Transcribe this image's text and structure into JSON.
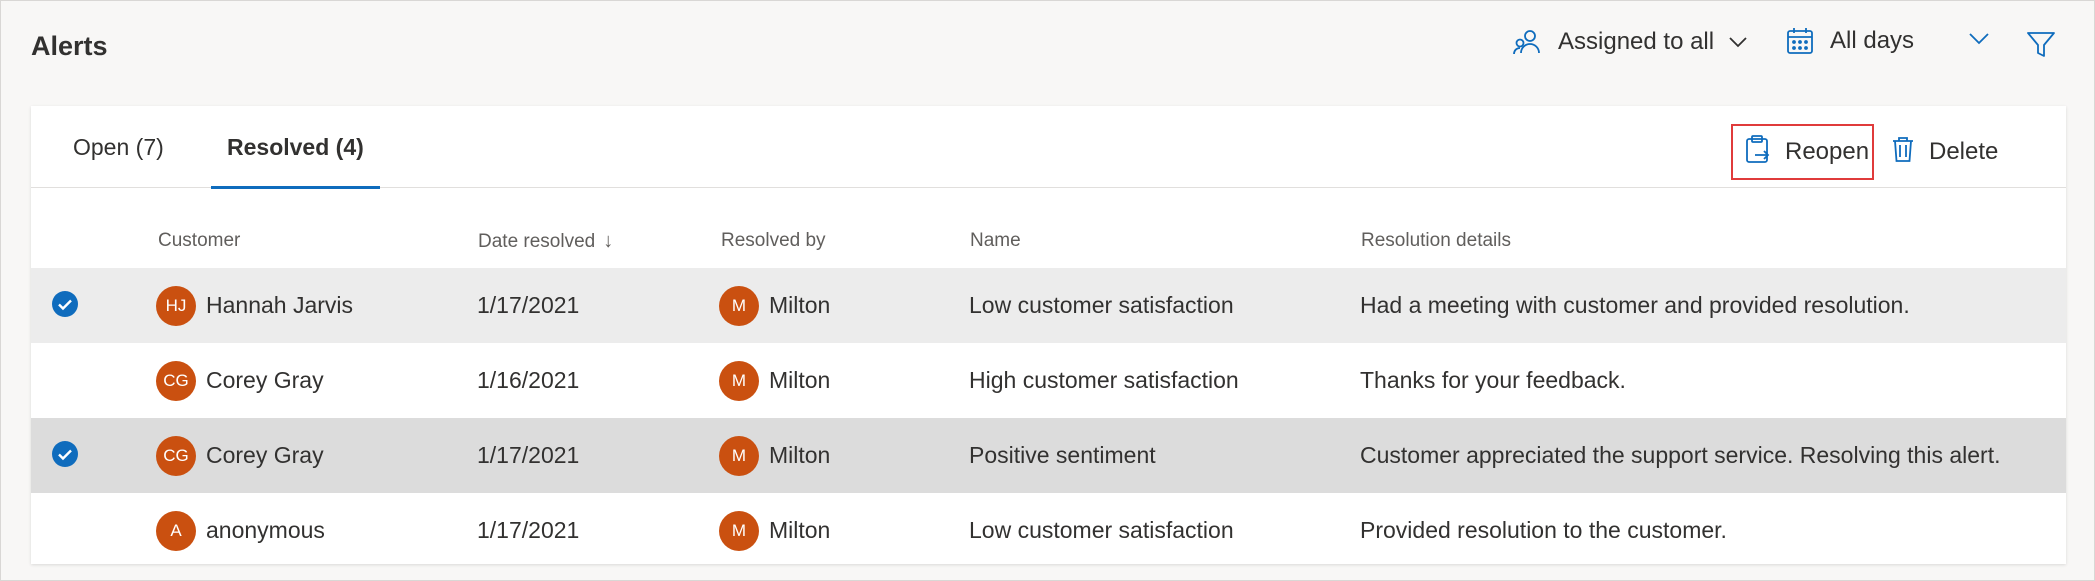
{
  "page": {
    "title": "Alerts"
  },
  "toolbar": {
    "assigned_label": "Assigned to all",
    "days_label": "All days"
  },
  "tabs": [
    {
      "label": "Open (7)",
      "active": false
    },
    {
      "label": "Resolved (4)",
      "active": true
    }
  ],
  "actions": {
    "reopen_label": "Reopen",
    "delete_label": "Delete"
  },
  "table": {
    "columns": {
      "customer": "Customer",
      "date": "Date resolved",
      "resolved_by": "Resolved by",
      "name": "Name",
      "details": "Resolution details"
    },
    "rows": [
      {
        "selected": true,
        "customer_initials": "HJ",
        "customer": "Hannah Jarvis",
        "date": "1/17/2021",
        "resolver_initials": "M",
        "resolved_by": "Milton",
        "name": "Low customer satisfaction",
        "details": "Had a meeting with customer and provided resolution."
      },
      {
        "selected": false,
        "customer_initials": "CG",
        "customer": "Corey Gray",
        "date": "1/16/2021",
        "resolver_initials": "M",
        "resolved_by": "Milton",
        "name": "High customer satisfaction",
        "details": "Thanks for your feedback."
      },
      {
        "selected": true,
        "customer_initials": "CG",
        "customer": "Corey Gray",
        "date": "1/17/2021",
        "resolver_initials": "M",
        "resolved_by": "Milton",
        "name": "Positive sentiment",
        "details": "Customer appreciated the support service. Resolving this alert."
      },
      {
        "selected": false,
        "customer_initials": "A",
        "customer": "anonymous",
        "date": "1/17/2021",
        "resolver_initials": "M",
        "resolved_by": "Milton",
        "name": "Low customer satisfaction",
        "details": "Provided resolution to the customer."
      }
    ]
  },
  "colors": {
    "accent": "#0f6cbd",
    "avatar": "#ca5010",
    "highlight_border": "#e03b3b"
  }
}
